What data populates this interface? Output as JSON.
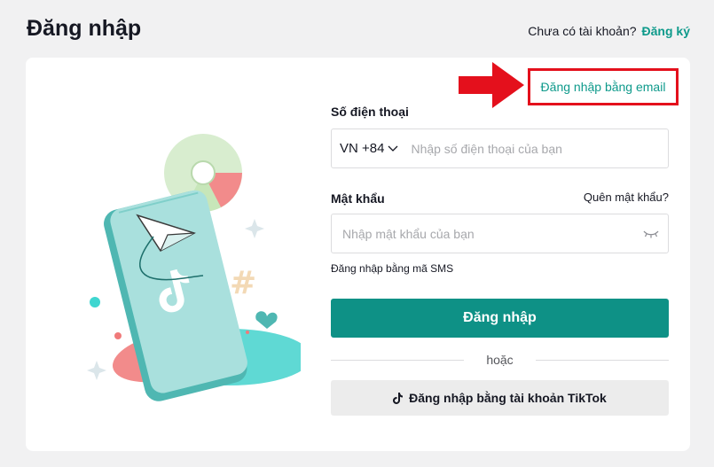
{
  "header": {
    "title": "Đăng nhập",
    "no_account_text": "Chưa có tài khoản?",
    "signup_link": "Đăng ký"
  },
  "email_login_link": "Đăng nhập bằng email",
  "form": {
    "phone_label": "Số điện thoại",
    "country_code": "VN +84",
    "phone_placeholder": "Nhập số điện thoại của bạn",
    "password_label": "Mật khẩu",
    "forgot_link": "Quên mật khẩu?",
    "password_placeholder": "Nhập mật khẩu của bạn",
    "sms_link": "Đăng nhập bằng mã SMS",
    "login_button": "Đăng nhập",
    "or_text": "hoặc",
    "tiktok_button": "Đăng nhập bằng tài khoản TikTok"
  },
  "colors": {
    "accent": "#0e9186",
    "link": "#0e9a8b",
    "highlight": "#e4101c"
  }
}
